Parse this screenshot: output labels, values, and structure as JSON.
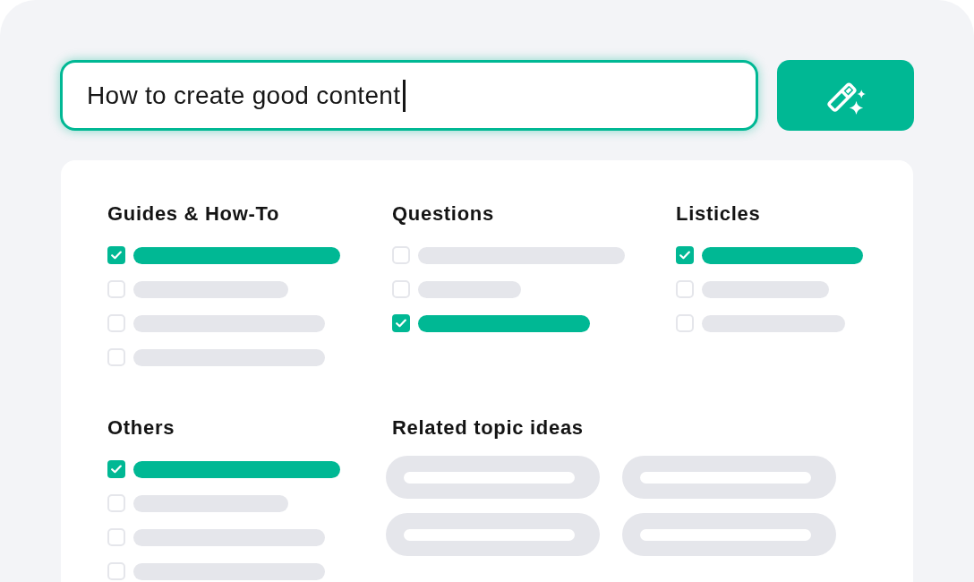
{
  "search": {
    "value": "How to create good content"
  },
  "categories": [
    {
      "title": "Guides & How-To",
      "items": [
        {
          "checked": true
        },
        {
          "checked": false
        },
        {
          "checked": false
        },
        {
          "checked": false
        }
      ]
    },
    {
      "title": "Questions",
      "items": [
        {
          "checked": false
        },
        {
          "checked": false
        },
        {
          "checked": true
        }
      ]
    },
    {
      "title": "Listicles",
      "items": [
        {
          "checked": true
        },
        {
          "checked": false
        },
        {
          "checked": false
        }
      ]
    },
    {
      "title": "Others",
      "items": [
        {
          "checked": true
        },
        {
          "checked": false
        },
        {
          "checked": false
        },
        {
          "checked": false
        }
      ]
    }
  ],
  "related_topics": {
    "title": "Related topic ideas"
  }
}
